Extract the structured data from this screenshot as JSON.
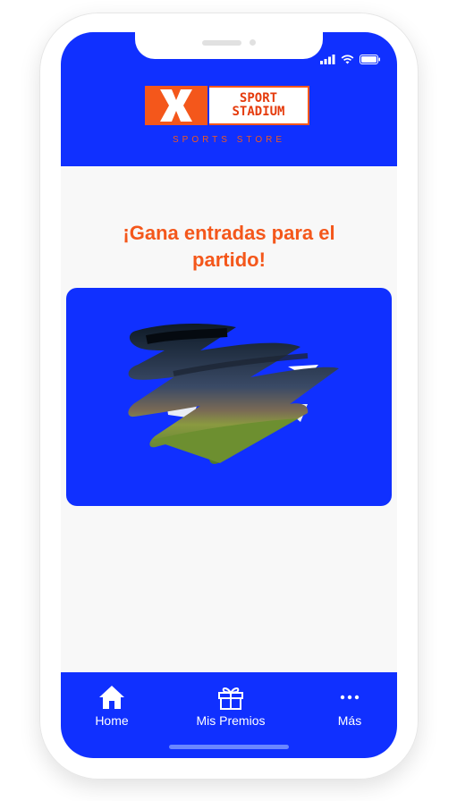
{
  "app": {
    "brand": {
      "mark": "X",
      "name": "SPORT\nSTADIUM",
      "tagline": "SPORTS STORE"
    }
  },
  "main": {
    "title": "¡Gana entradas para el partido!"
  },
  "nav": {
    "items": [
      {
        "label": "Home",
        "icon": "home-icon"
      },
      {
        "label": "Mis Premios",
        "icon": "gift-icon"
      },
      {
        "label": "Más",
        "icon": "more-icon"
      }
    ]
  },
  "colors": {
    "primary": "#1030ff",
    "accent": "#f4571b",
    "background": "#f8f8f8"
  }
}
